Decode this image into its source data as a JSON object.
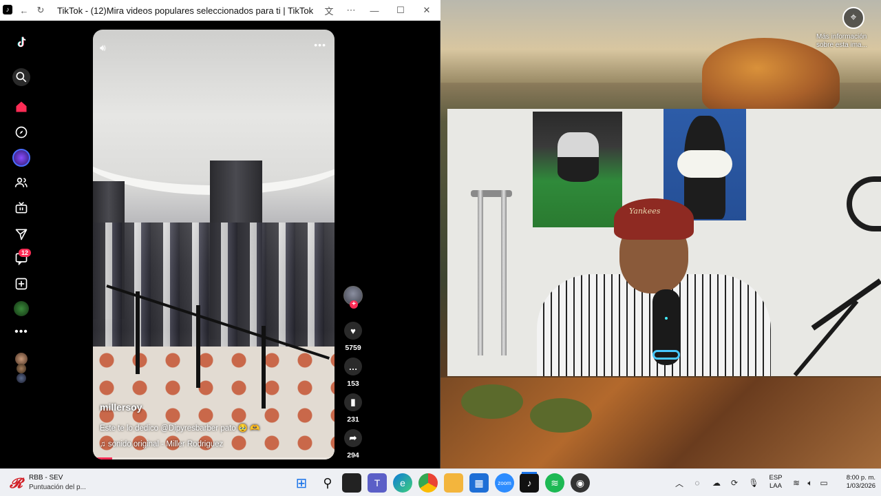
{
  "browser": {
    "title": "TikTok - (12)Mira videos populares seleccionados para ti | TikTok",
    "icons": [
      "tiktok-icon",
      "back-icon",
      "forward-icon",
      "refresh-icon",
      "translate-icon",
      "more-icon",
      "minimize-icon",
      "maximize-icon",
      "close-icon"
    ]
  },
  "sidebar": {
    "items": [
      {
        "name": "logo",
        "icon": "tiktok-logo-icon"
      },
      {
        "name": "search",
        "icon": "search-icon"
      },
      {
        "name": "for-you",
        "icon": "home-icon"
      },
      {
        "name": "explore",
        "icon": "compass-icon"
      },
      {
        "name": "live-avatar",
        "icon": "live-avatar-icon"
      },
      {
        "name": "following",
        "icon": "people-icon"
      },
      {
        "name": "live",
        "icon": "tv-icon"
      },
      {
        "name": "messages",
        "icon": "send-icon"
      },
      {
        "name": "inbox",
        "icon": "inbox-icon"
      },
      {
        "name": "upload",
        "icon": "upload-icon"
      },
      {
        "name": "profile",
        "icon": "profile-icon"
      },
      {
        "name": "more",
        "icon": "more-icon"
      }
    ],
    "inbox_badge": "12"
  },
  "video": {
    "author": "millersoy",
    "caption": "Este te lo dedico @Dipyresbarber  pato 🥹 🫶",
    "sound": "sonido original - Miller Rodriguez",
    "progress": 0.08,
    "accent_color": "#fe2c55"
  },
  "actions": {
    "likes": "5759",
    "comments": "153",
    "saves": "231",
    "shares": "294"
  },
  "wallpaper": {
    "info_text": "Más información sobre esta ima..."
  },
  "taskbar": {
    "widget_title": "RBB - SEV",
    "widget_subtitle": "Puntuación del p...",
    "apps": [
      "windows-start-icon",
      "search-icon",
      "task-view-icon",
      "teams-icon",
      "edge-icon",
      "chrome-icon",
      "file-explorer-icon",
      "store-icon",
      "zoom-icon",
      "tiktok-icon",
      "spotify-icon",
      "obs-icon"
    ],
    "lang_line1": "ESP",
    "lang_line2": "LAA",
    "time": "8:00 p. m.",
    "date": "1/03/2026"
  }
}
